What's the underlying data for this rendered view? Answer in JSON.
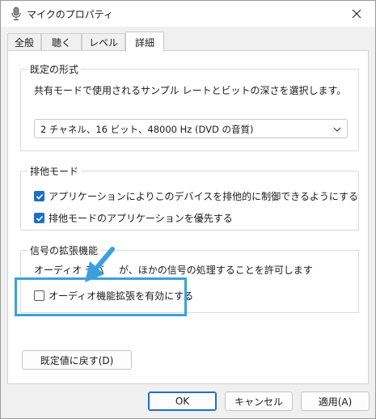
{
  "window": {
    "title": "マイクのプロパティ",
    "close_symbol": "✕"
  },
  "tabs": [
    {
      "label": "全般"
    },
    {
      "label": "聴く"
    },
    {
      "label": "レベル"
    },
    {
      "label": "詳細",
      "active": true
    }
  ],
  "default_format": {
    "title": "既定の形式",
    "description": "共有モードで使用されるサンプル レートとビットの深さを選択します。",
    "selected": "2 チャネル、16 ビット、48000 Hz (DVD の音質)"
  },
  "exclusive_mode": {
    "title": "排他モード",
    "options": [
      {
        "label": "アプリケーションによりこのデバイスを排他的に制御できるようにする",
        "checked": true
      },
      {
        "label": "排他モードのアプリケーションを優先する",
        "checked": true
      }
    ]
  },
  "signal_enhancements": {
    "title": "信号の拡張機能",
    "description_start": "オーディオ デバ",
    "description_end": "が、ほかの信号の処理することを許可します",
    "option": {
      "label": "オーディオ機能拡張を有効にする",
      "checked": false
    }
  },
  "restore_defaults_label": "既定値に戻す(D)",
  "buttons": {
    "ok": "OK",
    "cancel": "キャンセル",
    "apply": "適用(A)"
  },
  "colors": {
    "accent": "#1f6fc5",
    "annotation": "#3aa0dd"
  },
  "icons": {
    "title": "microphone-icon",
    "annotation": "pointer-arrow-icon"
  }
}
